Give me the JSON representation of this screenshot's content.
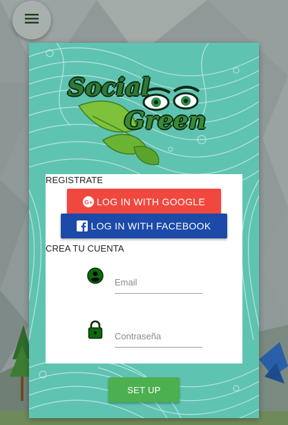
{
  "app": {
    "logo_line1": "Social",
    "logo_line2": "Green"
  },
  "icons": {
    "menu": "hamburger-menu-icon",
    "google": "google-plus-icon",
    "facebook": "facebook-icon",
    "user": "account-circle-icon",
    "lock": "lock-icon"
  },
  "register": {
    "title": "REGISTRATE",
    "google_label": "LOG IN WITH GOOGLE",
    "facebook_label": "LOG IN WITH FACEBOOK"
  },
  "create": {
    "title": "CREA TU CUENTA",
    "email_placeholder": "Email",
    "email_value": "",
    "password_placeholder": "Contraseña",
    "password_value": "",
    "submit_label": "SET UP"
  },
  "colors": {
    "google": "#f0483e",
    "facebook": "#1b4aa8",
    "setup": "#4caf50",
    "card": "#5fc3b2",
    "icon_green": "#0b6a0b"
  }
}
